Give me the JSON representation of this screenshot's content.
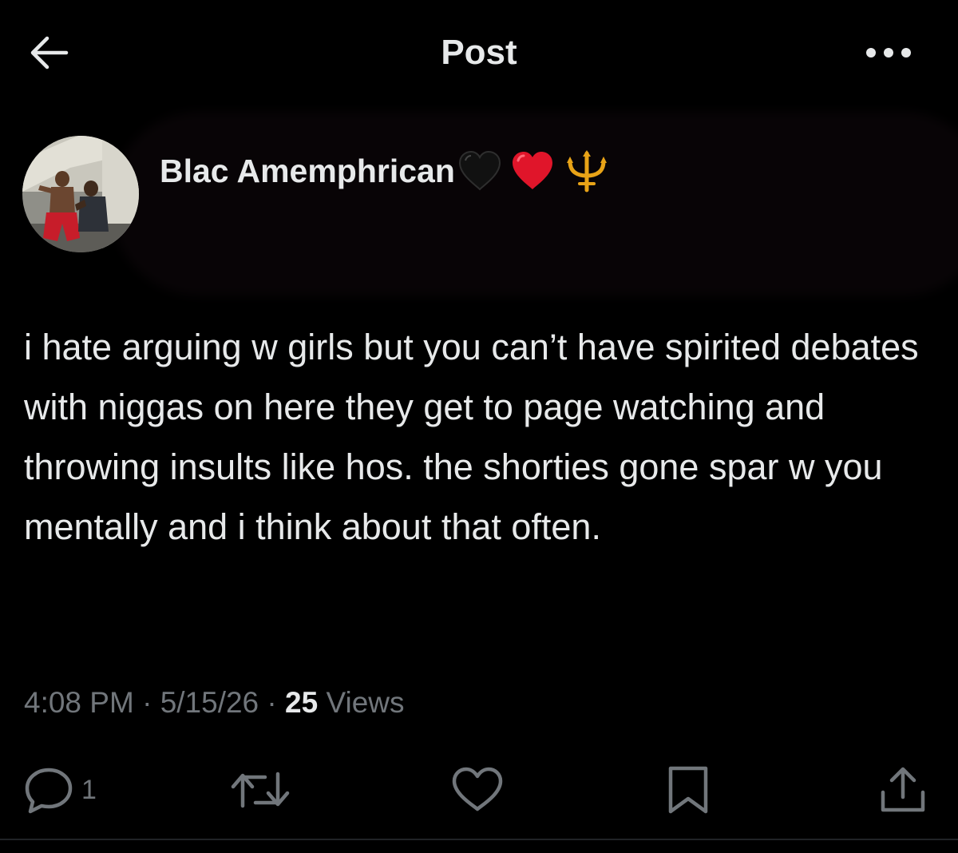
{
  "header": {
    "title": "Post",
    "back_icon": "arrow-left-icon",
    "more_icon": "more-dots-icon"
  },
  "author": {
    "display_name": "Blac Amemphrican",
    "emoji_badges": [
      "black-heart",
      "red-heart",
      "trident"
    ]
  },
  "post": {
    "text": "i hate arguing w girls but you can’t have spirited debates with niggas on here they get to page watching and throwing insults like hos. the shorties gone spar w you mentally and i think about that often."
  },
  "meta": {
    "time": "4:08 PM",
    "separator": "·",
    "date": "5/15/26",
    "views_count": "25",
    "views_label": "Views"
  },
  "actions": {
    "reply_count": "1"
  },
  "colors": {
    "background": "#000000",
    "text_primary": "#e7e9ea",
    "text_secondary": "#71767b",
    "heart_red": "#e0152a",
    "trident_gold": "#e8a317"
  }
}
